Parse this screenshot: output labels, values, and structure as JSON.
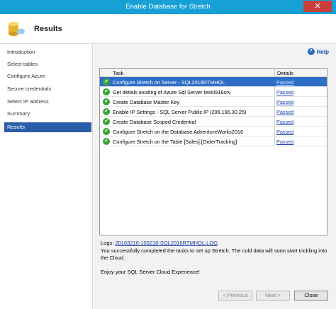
{
  "window": {
    "title": "Enable Database for Stretch",
    "close_glyph": "✕"
  },
  "banner": {
    "heading": "Results"
  },
  "sidebar": {
    "items": [
      {
        "label": "Introduction"
      },
      {
        "label": "Select tables"
      },
      {
        "label": "Configure Azure"
      },
      {
        "label": "Secure credentials"
      },
      {
        "label": "Select IP address"
      },
      {
        "label": "Summary"
      },
      {
        "label": "Results"
      }
    ],
    "selected": "Results"
  },
  "help": {
    "label": "Help"
  },
  "grid": {
    "columns": {
      "task": "Task",
      "details": "Details"
    },
    "rows": [
      {
        "task": "Configure Stretch on Server - SQL2016RTMHOL",
        "details": "Passed"
      },
      {
        "task": "Get details existing of Azure Sql Server test0916srv",
        "details": "Passed"
      },
      {
        "task": "Create Database Master Key",
        "details": "Passed"
      },
      {
        "task": "Enable IP Settings - SQL Server Public IP (206.196.30.25)",
        "details": "Passed"
      },
      {
        "task": "Create Database Scoped Credential",
        "details": "Passed"
      },
      {
        "task": "Configure Stretch on the Database AdventureWorks2016",
        "details": "Passed"
      },
      {
        "task": "Configure Stretch on the Table [Sales].[OrderTracking]",
        "details": "Passed"
      }
    ]
  },
  "logs": {
    "label": "Logs:",
    "link": "20163216-103218-SQL2016RTMHOL.LOG"
  },
  "message": "You successfully completed the tasks to set up Stretch. The cold data will soon start trickling into the Cloud.",
  "enjoy": "Enjoy your SQL Server Cloud Experience!",
  "buttons": {
    "previous": "< Previous",
    "next": "Next >",
    "close": "Close"
  },
  "colors": {
    "titlebar": "#17a0d6",
    "selection": "#2a5ea8",
    "success": "#3aa23a",
    "link": "#1a3fb0"
  }
}
